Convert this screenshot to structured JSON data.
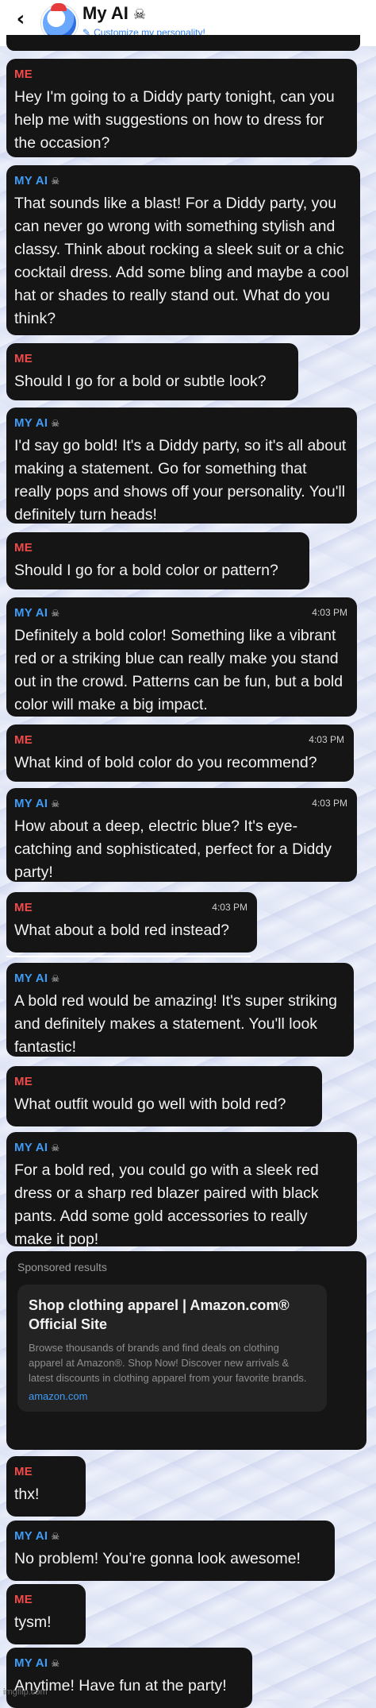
{
  "header": {
    "back_icon": "chevron-left-icon",
    "title": "My AI",
    "title_icon": "skull-icon",
    "subtitle": "Customize my personality!",
    "subtitle_icon": "pencil-icon"
  },
  "messages": [
    {
      "sender": "ME",
      "time": "",
      "text": "Hey I'm going to a Diddy party tonight, can you help me with suggestions on how to dress for the occasion?"
    },
    {
      "sender": "MY AI",
      "time": "",
      "text": "That sounds like a blast! For a Diddy party, you can never go wrong with something stylish and classy. Think about rocking a sleek suit or a chic cocktail dress. Add some bling and maybe a cool hat or shades to really stand out. What do you think?"
    },
    {
      "sender": "ME",
      "time": "",
      "text": "Should I go for a bold or subtle look?"
    },
    {
      "sender": "MY AI",
      "time": "",
      "text": "I'd say go bold! It's a Diddy party, so it's all about making a statement. Go for something that really pops and shows off your personality. You'll definitely turn heads!"
    },
    {
      "sender": "ME",
      "time": "",
      "text": "Should I go for a bold color or pattern?"
    },
    {
      "sender": "MY AI",
      "time": "4:03 PM",
      "text": "Definitely a bold color! Something like a vibrant red or a striking blue can really make you stand out in the crowd. Patterns can be fun, but a bold color will make a big impact."
    },
    {
      "sender": "ME",
      "time": "4:03 PM",
      "text": "What kind of bold color do you recommend?"
    },
    {
      "sender": "MY AI",
      "time": "4:03 PM",
      "text": "How about a deep, electric blue? It's eye-catching and sophisticated, perfect for a Diddy party!"
    },
    {
      "sender": "ME",
      "time": "4:03 PM",
      "text": "What about a bold red instead?"
    },
    {
      "sender": "MY AI",
      "time": "",
      "text": "A bold red would be amazing! It's super striking and definitely makes a statement. You'll look fantastic!"
    },
    {
      "sender": "ME",
      "time": "",
      "text": "What outfit would go well with bold red?"
    },
    {
      "sender": "MY AI",
      "time": "",
      "text": "For a bold red, you could go with a sleek red dress or a sharp red blazer paired with black pants. Add some gold accessories to really make it pop!"
    },
    {
      "sender": "ME",
      "time": "",
      "text": "thx!"
    },
    {
      "sender": "MY AI",
      "time": "",
      "text": "No problem! You’re gonna look awesome!"
    },
    {
      "sender": "ME",
      "time": "",
      "text": "tysm!"
    },
    {
      "sender": "MY AI",
      "time": "",
      "text": "Anytime! Have fun at the party!"
    }
  ],
  "sponsored": {
    "header": "Sponsored results",
    "title": "Shop clothing apparel | Amazon.com® Official Site",
    "description": "Browse thousands of brands and find deals on clothing apparel at Amazon®. Shop Now! Discover new arrivals & latest discounts in clothing apparel from your favorite brands.",
    "link": "amazon.com"
  },
  "watermark": "imgflip.com",
  "colors": {
    "me": "#f14a4a",
    "ai": "#3f9bf5",
    "bubble": "#151515",
    "link": "#2d7ff0"
  }
}
